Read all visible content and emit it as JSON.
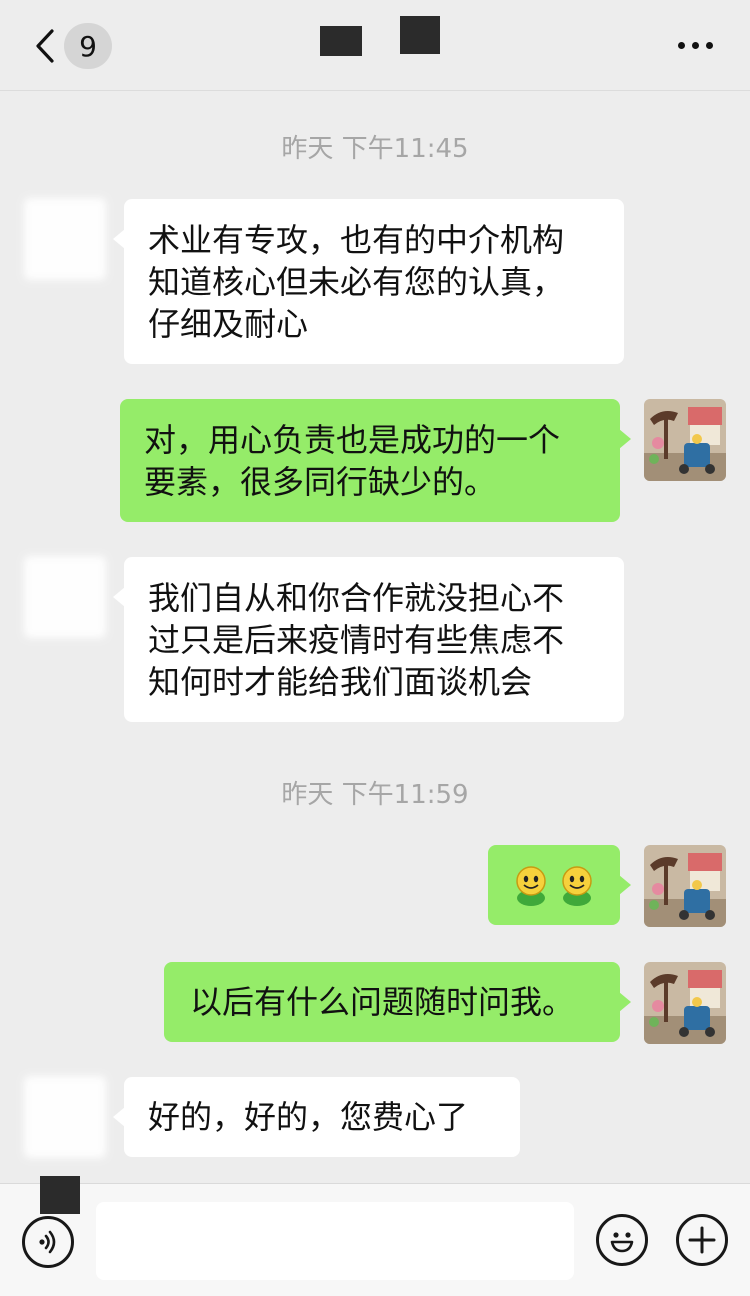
{
  "header": {
    "back_label": "<",
    "unread_count": "9",
    "title": "",
    "more_icon": "more-dots-icon"
  },
  "colors": {
    "background": "#ededed",
    "bubble_mine": "#95ec69",
    "bubble_theirs": "#ffffff",
    "timestamp": "#a6a6a6"
  },
  "timestamps": [
    "昨天 下午11:45",
    "昨天 下午11:59"
  ],
  "messages": [
    {
      "side": "left",
      "lines": [
        "术业有专攻，也有的中介机构",
        "知道核心但未必有您的认真，",
        "仔细及耐心"
      ]
    },
    {
      "side": "right",
      "lines": [
        "对，用心负责也是成功的一个",
        "要素，很多同行缺少的。"
      ]
    },
    {
      "side": "left",
      "lines": [
        "我们自从和你合作就没担心不",
        "过只是后来疫情时有些焦虑不",
        "知何时才能给我们面谈机会"
      ]
    },
    {
      "side": "right",
      "emoji": [
        "smiley-face-emoji",
        "smiley-face-emoji"
      ]
    },
    {
      "side": "right",
      "lines": [
        "以后有什么问题随时问我。"
      ]
    },
    {
      "side": "left",
      "lines": [
        "好的，好的，您费心了"
      ]
    }
  ],
  "input": {
    "placeholder": "",
    "voice_icon": "voice-icon",
    "emoji_icon": "emoji-icon",
    "plus_icon": "plus-icon"
  }
}
